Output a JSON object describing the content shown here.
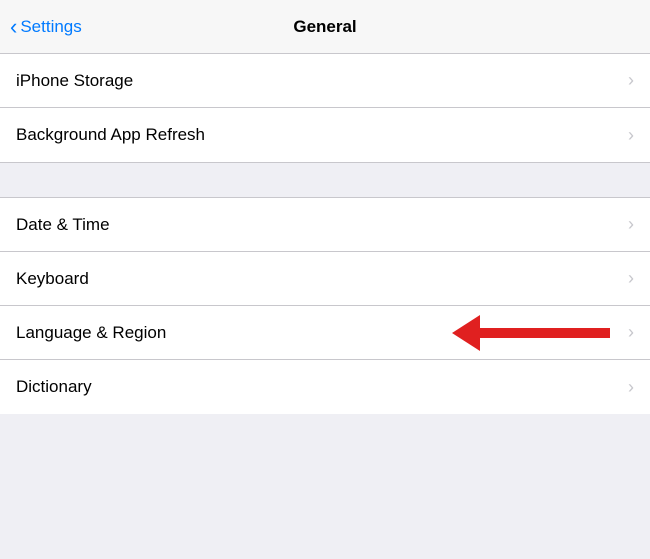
{
  "header": {
    "back_label": "Settings",
    "title": "General"
  },
  "sections": [
    {
      "items": [
        {
          "id": "iphone-storage",
          "label": "iPhone Storage"
        },
        {
          "id": "background-app-refresh",
          "label": "Background App Refresh"
        }
      ]
    },
    {
      "items": [
        {
          "id": "date-time",
          "label": "Date & Time"
        },
        {
          "id": "keyboard",
          "label": "Keyboard"
        },
        {
          "id": "language-region",
          "label": "Language & Region",
          "has_arrow": true
        },
        {
          "id": "dictionary",
          "label": "Dictionary"
        }
      ]
    }
  ],
  "chevron": "›",
  "colors": {
    "blue": "#007aff",
    "red_arrow": "#e02020",
    "separator": "#c8c7cc",
    "chevron": "#c7c7cc"
  }
}
